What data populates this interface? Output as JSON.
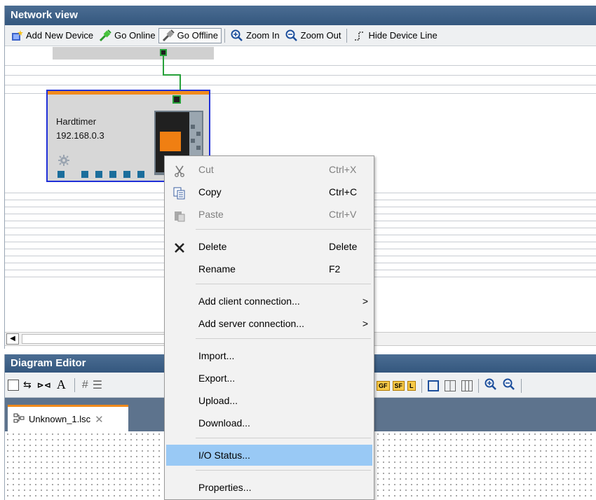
{
  "network_view": {
    "title": "Network view",
    "toolbar": {
      "add_new_device": "Add New Device",
      "go_online": "Go Online",
      "go_offline": "Go Offline",
      "zoom_in": "Zoom In",
      "zoom_out": "Zoom Out",
      "hide_device_line": "Hide Device Line"
    },
    "device": {
      "name": "Hardtimer",
      "ip": "192.168.0.3"
    }
  },
  "diagram_editor": {
    "title": "Diagram Editor",
    "toolbar_text": "A",
    "tags": [
      "GF",
      "SF",
      "L"
    ],
    "tab": {
      "label": "Unknown_1.lsc"
    }
  },
  "context_menu": {
    "items": [
      {
        "label": "Cut",
        "shortcut": "Ctrl+X",
        "disabled": true
      },
      {
        "label": "Copy",
        "shortcut": "Ctrl+C"
      },
      {
        "label": "Paste",
        "shortcut": "Ctrl+V",
        "disabled": true
      },
      {
        "label": "Delete",
        "shortcut": "Delete"
      },
      {
        "label": "Rename",
        "shortcut": "F2"
      },
      {
        "label": "Add client connection...",
        "submenu": ">"
      },
      {
        "label": "Add server connection...",
        "submenu": ">"
      },
      {
        "label": "Import..."
      },
      {
        "label": "Export..."
      },
      {
        "label": "Upload..."
      },
      {
        "label": "Download..."
      },
      {
        "label": "I/O Status...",
        "highlighted": true
      },
      {
        "label": "Properties..."
      }
    ]
  },
  "colors": {
    "title_bar": "#3d6087",
    "device_border": "#2030d8",
    "device_accent": "#f08a1c",
    "connection_line": "#27a13a",
    "menu_highlight": "#99c9f5"
  }
}
